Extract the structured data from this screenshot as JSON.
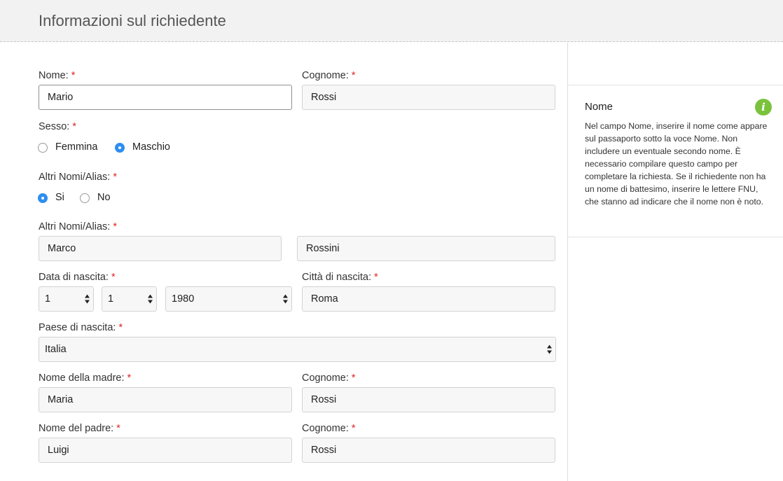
{
  "header": {
    "title": "Informazioni sul richiedente"
  },
  "form": {
    "required_mark": "*",
    "nome": {
      "label": "Nome:",
      "value": "Mario"
    },
    "cognome": {
      "label": "Cognome:",
      "value": "Rossi"
    },
    "sesso": {
      "label": "Sesso:",
      "options": [
        "Femmina",
        "Maschio"
      ],
      "selected": "Maschio"
    },
    "altri_nomi_flag": {
      "label": "Altri Nomi/Alias:",
      "options": [
        "Si",
        "No"
      ],
      "selected": "Si"
    },
    "altri_nomi": {
      "label": "Altri Nomi/Alias:",
      "first": "Marco",
      "last": "Rossini"
    },
    "data_nascita": {
      "label": "Data di nascita:",
      "day": "1",
      "month": "1",
      "year": "1980"
    },
    "citta_nascita": {
      "label": "Città di nascita:",
      "value": "Roma"
    },
    "paese_nascita": {
      "label": "Paese di nascita:",
      "value": "Italia"
    },
    "madre": {
      "label": "Nome della madre:",
      "value": "Maria",
      "cognome_label": "Cognome:",
      "cognome": "Rossi"
    },
    "padre": {
      "label": "Nome del padre:",
      "value": "Luigi",
      "cognome_label": "Cognome:",
      "cognome": "Rossi"
    }
  },
  "help": {
    "title": "Nome",
    "icon": "info-icon",
    "icon_color": "#7bc23c",
    "body": "Nel campo Nome, inserire il nome come appare sul passaporto sotto la voce Nome. Non includere un eventuale secondo nome. È necessario compilare questo campo per completare la richiesta. Se il richiedente non ha un nome di battesimo, inserire le lettere FNU, che stanno ad indicare che il nome non è noto."
  },
  "colors": {
    "accent": "#2d8ef2",
    "required": "#e02424",
    "header_bg": "#f2f2f2"
  }
}
